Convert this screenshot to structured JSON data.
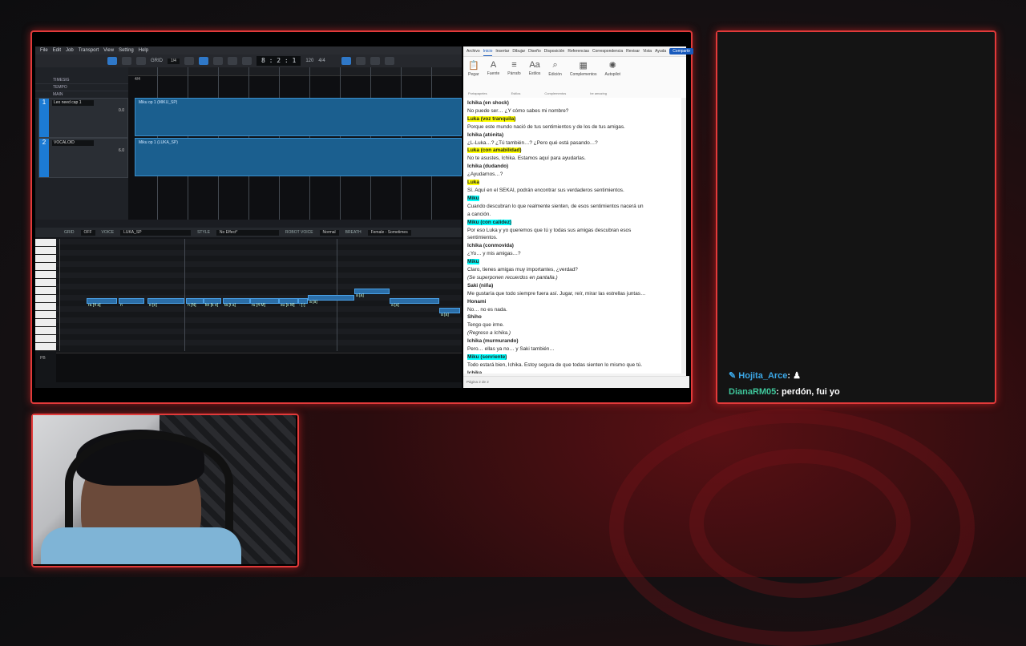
{
  "daw": {
    "menu": [
      "File",
      "Edit",
      "Job",
      "Transport",
      "View",
      "Setting",
      "Help"
    ],
    "grid_label": "GRID",
    "grid_value": "1/4",
    "counter": "8 : 2 : 1",
    "tempo_display": "120",
    "timesig_display": "4/4",
    "rows": [
      "TIMESIG",
      "TEMPO",
      "MAIN"
    ],
    "timesig_value": "4/4",
    "tempo_value": "120",
    "tracks": [
      {
        "number": "1",
        "name": "Leo need cap 1",
        "part": "Miku op 1 (MIKU_SP)",
        "volume": "0.0"
      },
      {
        "number": "2",
        "name": "VOCALOID",
        "part": "Miku op 1 (LUKA_SP)",
        "volume": "6.0"
      }
    ],
    "editor": {
      "grid_label": "GRID",
      "grid_value": "OFF",
      "voice_label": "VOICE",
      "voice_value": "LUKA_SP",
      "style_label": "STYLE",
      "style_value": "No Effect*",
      "robot_label": "ROBOT VOICE",
      "robot_value": "Normal",
      "breath_label": "BREATH",
      "breath_value": "Female - Sometimes",
      "pb_label": "PB",
      "notes": [
        {
          "label": "ra [4 a]"
        },
        {
          "label": "n"
        },
        {
          "label": "e [e]"
        },
        {
          "label": "n [N]"
        },
        {
          "label": "ko [k o]"
        },
        {
          "label": "ta [t a]"
        },
        {
          "label": "ru [4 M]"
        },
        {
          "label": "su [s M]"
        },
        {
          "label": "- [-]"
        },
        {
          "label": "a [a]"
        },
        {
          "label": "a [a]"
        },
        {
          "label": "a [a]"
        },
        {
          "label": "a [a]"
        }
      ]
    }
  },
  "word": {
    "tabs": [
      "Archivo",
      "Inicio",
      "Insertar",
      "Dibujar",
      "Diseño",
      "Disposición",
      "Referencias",
      "Correspondencia",
      "Revisar",
      "Vista",
      "Ayuda"
    ],
    "active_tab": "Inicio",
    "share_label": "Compartir",
    "ribbon": [
      "Pegar",
      "Fuente",
      "Párrafo",
      "Estilos",
      "Edición",
      "Complementos",
      "Autopilot"
    ],
    "ribbon_groups": [
      "Portapapeles",
      "Estilos",
      "Complementos",
      "be amazing"
    ],
    "lines": [
      {
        "t": "Ichika (en shock)",
        "s": "sp"
      },
      {
        "t": "No puede ser… ¿Y cómo sabes mi nombre?",
        "s": ""
      },
      {
        "t": "Luka (voz tranquila)",
        "s": "hl-y"
      },
      {
        "t": "Porque este mundo nació de tus sentimientos y de los de tus amigas.",
        "s": ""
      },
      {
        "t": "Ichika (atónita)",
        "s": "sp"
      },
      {
        "t": "¿L-Luka…? ¿Tú también…? ¿Pero qué está pasando…?",
        "s": ""
      },
      {
        "t": "Luka (con amabilidad)",
        "s": "hl-y"
      },
      {
        "t": "No te asustes, Ichika. Estamos aquí para ayudarlas.",
        "s": ""
      },
      {
        "t": "Ichika (dudando)",
        "s": "sp"
      },
      {
        "t": "¿Ayudarnos…?",
        "s": ""
      },
      {
        "t": "Luka",
        "s": "hl-y"
      },
      {
        "t": "Sí. Aquí en el SEKAI, podrán encontrar sus verdaderos sentimientos.",
        "s": ""
      },
      {
        "t": "Miku",
        "s": "hl-c"
      },
      {
        "t": "Cuando descubran lo que realmente sienten, de esos sentimientos nacerá un",
        "s": ""
      },
      {
        "t": "a canción.",
        "s": ""
      },
      {
        "t": "Miku (con calidez)",
        "s": "hl-c"
      },
      {
        "t": "Por eso Luka y yo queremos que tú y todas sus amigas descubran esos",
        "s": ""
      },
      {
        "t": "sentimientos.",
        "s": ""
      },
      {
        "t": "Ichika (conmovida)",
        "s": "sp"
      },
      {
        "t": "¿Yo… y mis amigas…?",
        "s": ""
      },
      {
        "t": "Miku",
        "s": "hl-c"
      },
      {
        "t": "Claro, tienes amigas muy importantes, ¿verdad?",
        "s": ""
      },
      {
        "t": "(Se superponen recuerdos en pantalla.)",
        "s": "it"
      },
      {
        "t": "Saki (niña)",
        "s": "sp"
      },
      {
        "t": "Me gustaría que todo siempre fuera así. Jugar, reír, mirar las estrellas juntas…",
        "s": ""
      },
      {
        "t": "Honami",
        "s": "sp"
      },
      {
        "t": "No… no es nada.",
        "s": ""
      },
      {
        "t": "Shiho",
        "s": "sp"
      },
      {
        "t": "Tengo que irme.",
        "s": ""
      },
      {
        "t": "(Regreso a Ichika.)",
        "s": "it"
      },
      {
        "t": "Ichika (murmurando)",
        "s": "sp"
      },
      {
        "t": "Pero… ellas ya no… y Saki también…",
        "s": ""
      },
      {
        "t": "Miku (sonriente)",
        "s": "hl-c"
      },
      {
        "t": "Todo estará bien, Ichika. Estoy segura de que todas sienten lo mismo que tú.",
        "s": ""
      },
      {
        "t": "Ichika",
        "s": "sp"
      }
    ],
    "status": "Página 2 de 2"
  },
  "chat": {
    "messages": [
      {
        "user": "Hojita_Arce",
        "text": "♟",
        "user_color": "#3ba7e6"
      },
      {
        "user": "DianaRM05",
        "text": "perdón, fui yo",
        "user_color": "#3fc79b"
      }
    ]
  },
  "colors": {
    "frame": "#e23a3a",
    "accent": "#1c7bd4"
  }
}
